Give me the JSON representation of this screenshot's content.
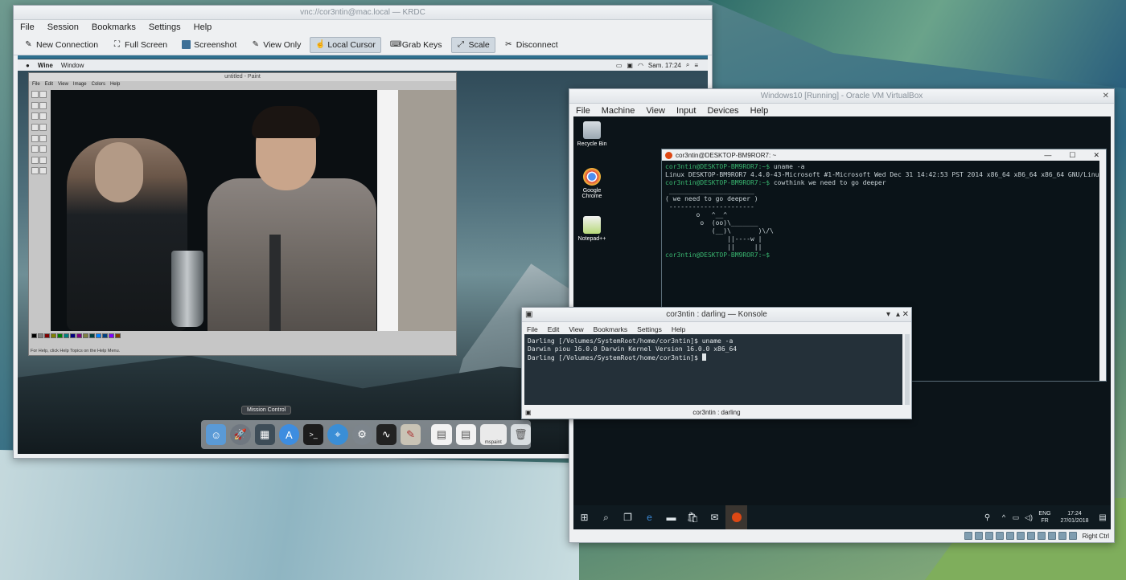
{
  "krdc": {
    "title": "vnc://cor3ntin@mac.local — KRDC",
    "menu": [
      "File",
      "Session",
      "Bookmarks",
      "Settings",
      "Help"
    ],
    "toolbar": [
      {
        "label": "New Connection",
        "icon": "pen-icon",
        "pressed": false
      },
      {
        "label": "Full Screen",
        "icon": "fullscreen-icon",
        "pressed": false
      },
      {
        "label": "Screenshot",
        "icon": "camera-icon",
        "pressed": false
      },
      {
        "label": "View Only",
        "icon": "pen-icon",
        "pressed": false
      },
      {
        "label": "Local Cursor",
        "icon": "cursor-icon",
        "pressed": true
      },
      {
        "label": "Grab Keys",
        "icon": "keys-icon",
        "pressed": false
      },
      {
        "label": "Scale",
        "icon": "scale-icon",
        "pressed": true
      },
      {
        "label": "Disconnect",
        "icon": "disconnect-icon",
        "pressed": false
      }
    ]
  },
  "mac": {
    "menubar": {
      "apple": "",
      "app": "Wine",
      "menu": "Window",
      "clock": "Sam. 17:24"
    },
    "paint": {
      "title": "untitled - Paint",
      "menu": [
        "File",
        "Edit",
        "View",
        "Image",
        "Colors",
        "Help"
      ],
      "status": "For Help, click Help Topics on the Help Menu."
    },
    "dock_tooltip": "Mission Control",
    "dock_icons": [
      "finder-icon",
      "launchpad-icon",
      "mission-control-icon",
      "appstore-icon",
      "terminal-icon",
      "safari-icon",
      "settings-icon",
      "activity-icon",
      "pencil-icon",
      "doc-icon",
      "doc-icon",
      "mspaint-icon",
      "trash-icon"
    ],
    "dock_mspaint_label": "mspaint"
  },
  "vbox": {
    "title": "Windows10 [Running] - Oracle VM VirtualBox",
    "menu": [
      "File",
      "Machine",
      "View",
      "Input",
      "Devices",
      "Help"
    ],
    "desktop_icons": [
      "Recycle Bin",
      "Google Chrome",
      "Notepad++"
    ],
    "bash": {
      "title": "cor3ntin@DESKTOP-BM9ROR7: ~",
      "prompt": "cor3ntin@DESKTOP-BM9ROR7:~$",
      "lines": [
        {
          "prompt": true,
          "text": " uname -a"
        },
        {
          "prompt": false,
          "text": "Linux DESKTOP-BM9ROR7 4.4.0-43-Microsoft #1-Microsoft Wed Dec 31 14:42:53 PST 2014 x86_64 x86_64 x86_64 GNU/Linux"
        },
        {
          "prompt": true,
          "text": " cowthink we need to go deeper"
        },
        {
          "prompt": false,
          "text": " ______________________"
        },
        {
          "prompt": false,
          "text": "( we need to go deeper )"
        },
        {
          "prompt": false,
          "text": " ----------------------"
        },
        {
          "prompt": false,
          "text": "        o   ^__^"
        },
        {
          "prompt": false,
          "text": "         o  (oo)\\_______"
        },
        {
          "prompt": false,
          "text": "            (__)\\       )\\/\\"
        },
        {
          "prompt": false,
          "text": "                ||----w |"
        },
        {
          "prompt": false,
          "text": "                ||     ||"
        },
        {
          "prompt": true,
          "text": ""
        }
      ]
    },
    "taskbar": {
      "lang": "ENG",
      "lang2": "FR",
      "time": "17:24",
      "date": "27/01/2018"
    },
    "status_right": "Right Ctrl"
  },
  "konsole": {
    "title": "cor3ntin : darling — Konsole",
    "menu": [
      "File",
      "Edit",
      "View",
      "Bookmarks",
      "Settings",
      "Help"
    ],
    "lines": [
      "Darling [/Volumes/SystemRoot/home/cor3ntin]$ uname -a",
      "Darwin piou 16.0.0 Darwin Kernel Version 16.0.0 x86_64",
      "Darling [/Volumes/SystemRoot/home/cor3ntin]$ "
    ],
    "tab_label": "cor3ntin : darling"
  }
}
